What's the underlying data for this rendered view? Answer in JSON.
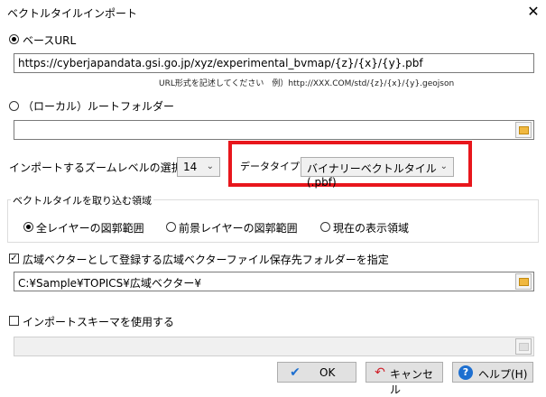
{
  "window": {
    "title": "ベクトルタイルインポート",
    "close_glyph": "✕"
  },
  "base_url": {
    "label": "ベースURL",
    "value": "https://cyberjapandata.gsi.go.jp/xyz/experimental_bvmap/{z}/{x}/{y}.pbf",
    "hint": "URL形式を記述してください　例）http://XXX.COM/std/{z}/{x}/{y}.geojson",
    "selected": true
  },
  "local_folder": {
    "label": "（ローカル）ルートフォルダー",
    "value": "",
    "selected": false
  },
  "zoom": {
    "label": "インポートするズームレベルの選択",
    "value": "14"
  },
  "data_type": {
    "label": "データタイプ",
    "value": "バイナリーベクトルタイル (.pbf)",
    "highlight_color": "#e8161c"
  },
  "range_group": {
    "label": "ベクトルタイルを取り込む領域",
    "options": [
      "全レイヤーの図郭範囲",
      "前景レイヤーの図郭範囲",
      "現在の表示領域"
    ],
    "selected_index": 0
  },
  "wide_vector": {
    "checkbox_label": "広域ベクターとして登録する",
    "checked": true,
    "folder_label": "広域ベクターファイル保存先フォルダーを指定",
    "folder_value": "C:¥Sample¥TOPICS¥広域ベクター¥"
  },
  "schema": {
    "checkbox_label": "インポートスキーマを使用する",
    "checked": false,
    "value": ""
  },
  "buttons": {
    "ok": "OK",
    "ok_icon": "✔",
    "cancel": "キャンセル",
    "cancel_icon": "↶",
    "help": "ヘルプ(H)",
    "help_icon": "?"
  }
}
